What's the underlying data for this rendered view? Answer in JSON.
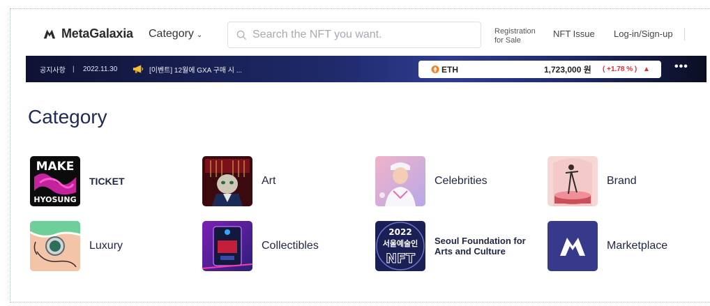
{
  "header": {
    "logo_text": "MetaGalaxia",
    "category_menu": "Category",
    "search_placeholder": "Search the NFT you want.",
    "nav": {
      "registration_line1": "Registration",
      "registration_line2": "for Sale",
      "nft_issue": "NFT Issue",
      "login": "Log-in/Sign-up"
    }
  },
  "notice": {
    "label": "공지사항",
    "separator": "|",
    "date": "2022.11.30",
    "text": "[이벤트] 12월에 GXA 구매 시 ...",
    "icon": "megaphone-icon"
  },
  "ticker": {
    "coin": "ETH",
    "price": "1,723,000 원",
    "change": "( +1.78 % )",
    "direction_symbol": "▲",
    "more": "•••",
    "up_color": "#e22b2b"
  },
  "category": {
    "title": "Category",
    "items": [
      {
        "label": "TICKET",
        "thumb_text_top": "MAKE",
        "thumb_text_bottom": "HYOSUNG"
      },
      {
        "label": "Art"
      },
      {
        "label": "Celebrities"
      },
      {
        "label": "Brand"
      },
      {
        "label": "Luxury"
      },
      {
        "label": "Collectibles"
      },
      {
        "label_line1": "Seoul Foundation for",
        "label_line2": "Arts and Culture",
        "thumb_text_top": "2022",
        "thumb_text_mid": "서울예술인",
        "thumb_text_bottom": "NFT"
      },
      {
        "label": "Marketplace"
      }
    ]
  }
}
